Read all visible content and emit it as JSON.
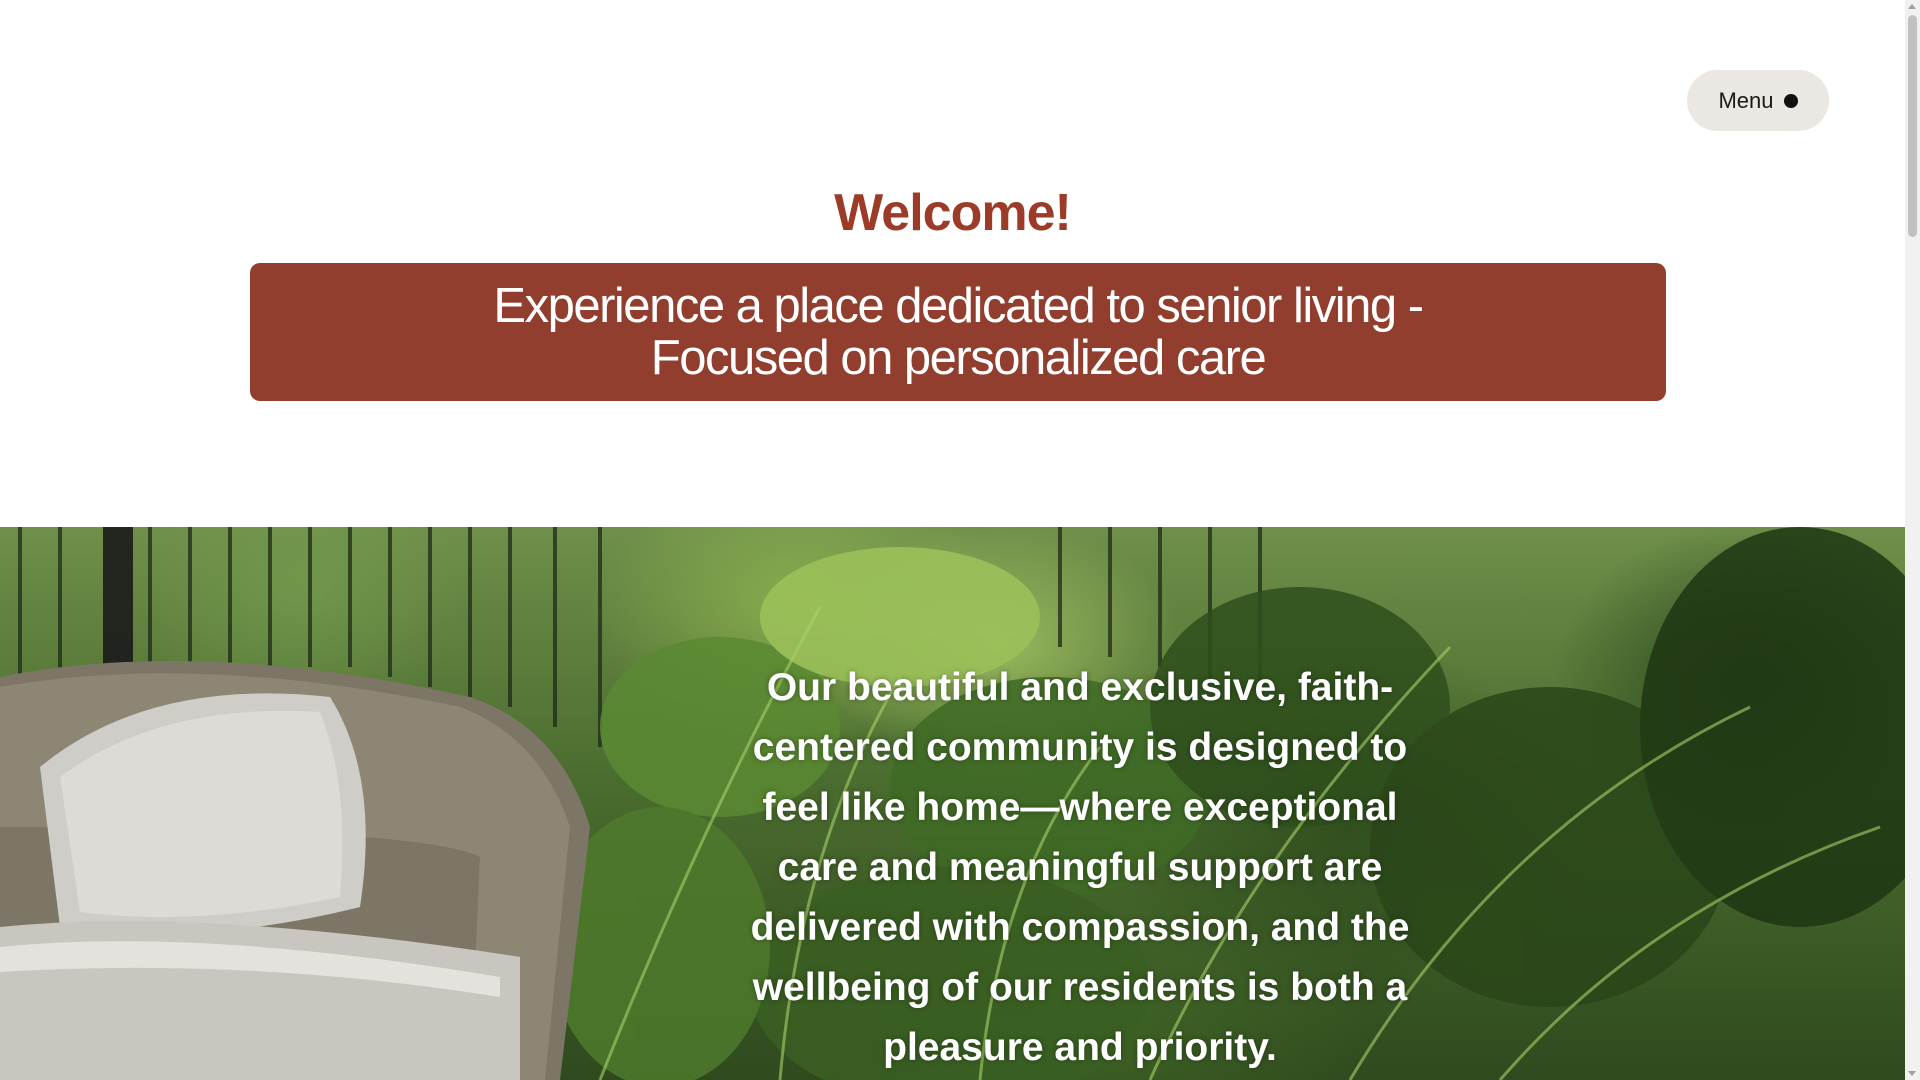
{
  "header": {
    "menu_label": "Menu",
    "menu_icon": "dot-icon"
  },
  "welcome": {
    "title": "Welcome!",
    "tagline": "Experience a place dedicated to senior living - Focused on personalized care"
  },
  "hero": {
    "image_subject": "wicker chair with cushion beside lush green plants",
    "text": "Our beautiful and exclusive, faith-centered community is designed to feel like home—where exceptional care and meaningful support are delivered with compassion, and the wellbeing of our residents is both a pleasure and priority."
  },
  "colors": {
    "accent": "#923e2f",
    "title": "#9b3b28",
    "menu_bg": "#ebe7e2"
  }
}
